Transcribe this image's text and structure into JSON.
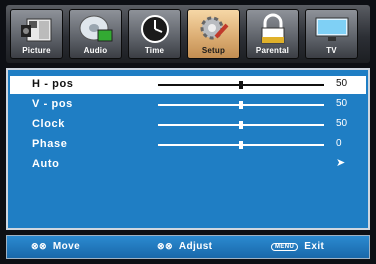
{
  "tabs": [
    {
      "label": "Picture",
      "icon": "picture-icon",
      "active": false
    },
    {
      "label": "Audio",
      "icon": "audio-icon",
      "active": false
    },
    {
      "label": "Time",
      "icon": "clock-icon",
      "active": false
    },
    {
      "label": "Setup",
      "icon": "setup-icon",
      "active": true
    },
    {
      "label": "Parental",
      "icon": "lock-icon",
      "active": false
    },
    {
      "label": "TV",
      "icon": "tv-icon",
      "active": false
    }
  ],
  "settings": [
    {
      "name": "H - pos",
      "value": "50",
      "level": 0.5,
      "selected": true
    },
    {
      "name": "V - pos",
      "value": "50",
      "level": 0.5,
      "selected": false
    },
    {
      "name": "Clock",
      "value": "50",
      "level": 0.5,
      "selected": false
    },
    {
      "name": "Phase",
      "value": "0",
      "level": 0.5,
      "selected": false
    },
    {
      "name": "Auto",
      "arrow": "➤",
      "selected": false
    }
  ],
  "footer": {
    "move_icon": "⊗⊗",
    "move_label": "Move",
    "adjust_icon": "⊗⊗",
    "adjust_label": "Adjust",
    "menu_key": "MENU",
    "exit_label": "Exit"
  },
  "colors": {
    "panel": "#1f7ec4",
    "active_tab": "#dcae74"
  }
}
